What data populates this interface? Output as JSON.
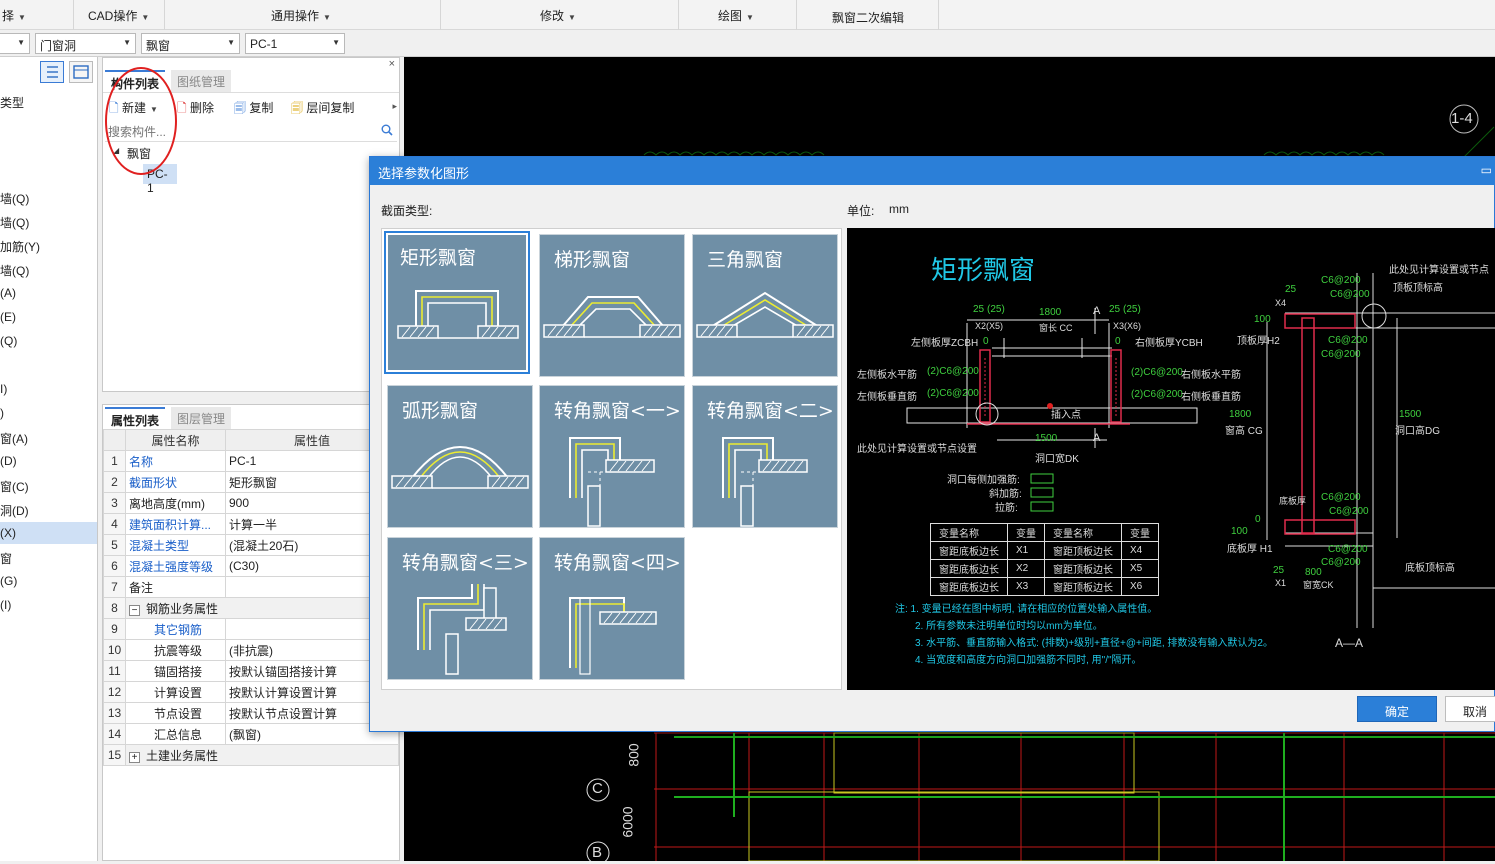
{
  "top_menu": {
    "m0": "择",
    "m1": "CAD操作",
    "m2": "通用操作",
    "m3": "修改",
    "m4": "绘图",
    "m5": "飘窗二次编辑"
  },
  "combos": {
    "c1": "门窗洞",
    "c2": "飘窗",
    "c3": "PC-1"
  },
  "left_nav": [
    "类型",
    "墙(Q)",
    "墙(Q)",
    "加筋(Y)",
    "墙(Q)",
    "(A)",
    "(E)",
    "(Q)",
    "I)",
    ")",
    "窗(A)",
    "(D)",
    "窗(C)",
    "洞(D)",
    "(X)",
    "窗",
    "(G)",
    "(I)"
  ],
  "component_panel": {
    "tab_active": "构件列表",
    "tab_other": "图纸管理",
    "toolbar": {
      "new": "新建",
      "delete": "删除",
      "copy": "复制",
      "floor_copy": "层间复制"
    },
    "search_placeholder": "搜索构件...",
    "tree": {
      "parent": "飘窗",
      "child": "PC-1"
    }
  },
  "property_panel": {
    "tab_active": "属性列表",
    "tab_other": "图层管理",
    "col_name": "属性名称",
    "col_value": "属性值",
    "rows": [
      {
        "n": "1",
        "name": "名称",
        "value": "PC-1"
      },
      {
        "n": "2",
        "name": "截面形状",
        "value": "矩形飘窗"
      },
      {
        "n": "3",
        "name": "离地高度(mm)",
        "value": "900"
      },
      {
        "n": "4",
        "name": "建筑面积计算...",
        "value": "计算一半"
      },
      {
        "n": "5",
        "name": "混凝土类型",
        "value": "(混凝土20石)"
      },
      {
        "n": "6",
        "name": "混凝土强度等级",
        "value": "(C30)"
      },
      {
        "n": "7",
        "name": "备注",
        "value": ""
      },
      {
        "n": "8",
        "name": "钢筋业务属性",
        "value": ""
      },
      {
        "n": "9",
        "name": "其它钢筋",
        "value": ""
      },
      {
        "n": "10",
        "name": "抗震等级",
        "value": "(非抗震)"
      },
      {
        "n": "11",
        "name": "锚固搭接",
        "value": "按默认锚固搭接计算"
      },
      {
        "n": "12",
        "name": "计算设置",
        "value": "按默认计算设置计算"
      },
      {
        "n": "13",
        "name": "节点设置",
        "value": "按默认节点设置计算"
      },
      {
        "n": "14",
        "name": "汇总信息",
        "value": "(飘窗)"
      },
      {
        "n": "15",
        "name": "土建业务属性",
        "value": ""
      }
    ]
  },
  "dialog": {
    "title": "选择参数化图形",
    "section_label": "截面类型:",
    "unit_label": "单位:",
    "unit_value": "mm",
    "shapes": [
      "矩形飘窗",
      "梯形飘窗",
      "三角飘窗",
      "弧形飘窗",
      "转角飘窗<一>",
      "转角飘窗<二>",
      "转角飘窗<三>",
      "转角飘窗<四>"
    ],
    "ok": "确定",
    "cancel": "取消",
    "preview": {
      "title": "矩形飘窗",
      "t_25a": "25",
      "t_25x5": "(25)",
      "t_1800": "1800",
      "t_A": "A",
      "t_25b": "25",
      "t_25x6": "(25)",
      "t_x2x5": "X2(X5)",
      "t_cc": "窗长 CC",
      "t_x3x6": "X3(X6)",
      "t_zcbh": "左侧板厚ZCBH",
      "t_0a": "0",
      "t_0b": "0",
      "t_ycbh": "右侧板厚YCBH",
      "t_lh": "左侧板水平筋",
      "t_lh2": "(2)C6@200",
      "t_rh2": "(2)C6@200",
      "t_rh": "右侧板水平筋",
      "t_lv": "左侧板垂直筋",
      "t_lv2": "(2)C6@200",
      "t_rv2": "(2)C6@200",
      "t_rv": "右侧板垂直筋",
      "t_ins": "插入点",
      "t_note1": "此处见计算设置或节点设置",
      "t_1500": "1500",
      "t_dk": "洞口宽DK",
      "t_A2": "A",
      "t_hole": "洞口每侧加强筋:",
      "t_slant": "斜加筋:",
      "t_tie": "拉筋:",
      "var_headers": [
        "变量名称",
        "变量",
        "变量名称",
        "变量"
      ],
      "var_rows": [
        [
          "窗距底板边长",
          "X1",
          "窗距顶板边长",
          "X4"
        ],
        [
          "窗距底板边长",
          "X2",
          "窗距顶板边长",
          "X5"
        ],
        [
          "窗距底板边长",
          "X3",
          "窗距顶板边长",
          "X6"
        ]
      ],
      "notes": [
        "注: 1. 变量已经在图中标明, 请在相应的位置处输入属性值。",
        "2. 所有参数未注明单位时均以mm为单位。",
        "3. 水平筋、垂直筋输入格式: (排数)+级别+直径+@+间距, 排数没有输入默认为2。",
        "4. 当宽度和高度方向洞口加强筋不同时, 用\"/\"隔开。"
      ],
      "r_note": "此处见计算设置或节点",
      "r_top": "顶板顶标高",
      "r_25": "25",
      "r_x4": "X4",
      "r_100": "100",
      "r_h2": "顶板厚H2",
      "r_c1": "C6@200",
      "r_c2": "C6@200",
      "r_c3": "C6@200",
      "r_c4": "C6@200",
      "r_1800": "1800",
      "r_cg": "窗高 CG",
      "r_1500": "1500",
      "r_dg": "洞口高DG",
      "r_bot": "底板厚",
      "r_100b": "100",
      "r_h1": "底板厚 H1",
      "r_0": "0",
      "r_c5": "C6@200",
      "r_c6": "C6@200",
      "r_c7": "C6@200",
      "r_c8": "C6@200",
      "r_25b": "25",
      "r_x1": "X1",
      "r_800": "800",
      "r_ck": "窗宽CK",
      "r_botel": "底板顶标高",
      "r_aa": "A—A"
    }
  },
  "cad": {
    "label_14": "1-4",
    "label_c": "C",
    "label_b": "B",
    "dim_800": "800",
    "dim_6000": "6000"
  }
}
